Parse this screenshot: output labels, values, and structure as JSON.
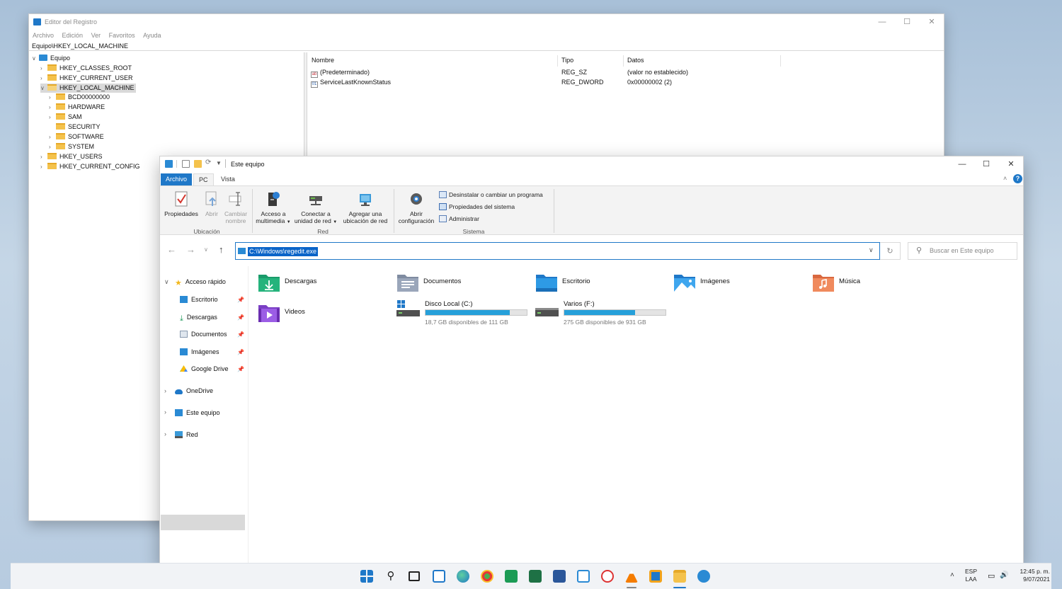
{
  "regedit": {
    "title": "Editor del Registro",
    "menu": [
      "Archivo",
      "Edición",
      "Ver",
      "Favoritos",
      "Ayuda"
    ],
    "address": "Equipo\\HKEY_LOCAL_MACHINE",
    "tree": {
      "root": "Equipo",
      "hkcr": "HKEY_CLASSES_ROOT",
      "hkcu": "HKEY_CURRENT_USER",
      "hklm": "HKEY_LOCAL_MACHINE",
      "bcd": "BCD00000000",
      "hardware": "HARDWARE",
      "sam": "SAM",
      "security": "SECURITY",
      "software": "SOFTWARE",
      "system": "SYSTEM",
      "hku": "HKEY_USERS",
      "hkcc": "HKEY_CURRENT_CONFIG"
    },
    "columns": {
      "name": "Nombre",
      "type": "Tipo",
      "data": "Datos"
    },
    "values": [
      {
        "name": "(Predeterminado)",
        "type": "REG_SZ",
        "data": "(valor no establecido)",
        "icon": "string-value-icon"
      },
      {
        "name": "ServiceLastKnownStatus",
        "type": "REG_DWORD",
        "data": "0x00000002 (2)",
        "icon": "dword-value-icon"
      }
    ]
  },
  "explorer": {
    "title": "Este equipo",
    "tabs": {
      "archivo": "Archivo",
      "pc": "PC",
      "vista": "Vista"
    },
    "ribbon": {
      "propiedades": "Propiedades",
      "abrir": "Abrir",
      "cambiar1": "Cambiar",
      "cambiar2": "nombre",
      "ubicacion_group": "Ubicación",
      "multimedia1": "Acceso a",
      "multimedia2": "multimedia",
      "conectar1": "Conectar a",
      "conectar2": "unidad de red",
      "agregar1": "Agregar una",
      "agregar2": "ubicación de red",
      "red_group": "Red",
      "config1": "Abrir",
      "config2": "configuración",
      "desinstalar": "Desinstalar o cambiar un programa",
      "propsistema": "Propiedades del sistema",
      "administrar": "Administrar",
      "sistema_group": "Sistema"
    },
    "address_value": "C:\\Windows\\regedit.exe",
    "search_placeholder": "Buscar en Este equipo",
    "nav": {
      "acceso_rapido": "Acceso rápido",
      "escritorio": "Escritorio",
      "descargas": "Descargas",
      "documentos": "Documentos",
      "imagenes": "Imágenes",
      "google_drive": "Google Drive",
      "onedrive": "OneDrive",
      "este_equipo": "Este equipo",
      "red": "Red"
    },
    "folders": {
      "descargas": "Descargas",
      "documentos": "Documentos",
      "escritorio": "Escritorio",
      "imagenes": "Imágenes",
      "musica": "Música",
      "videos": "Videos"
    },
    "drives": [
      {
        "name": "Disco Local (C:)",
        "space": "18,7 GB disponibles de 111 GB",
        "used_fraction": 0.83
      },
      {
        "name": "Varios (F:)",
        "space": "275 GB disponibles de 931 GB",
        "used_fraction": 0.7
      }
    ]
  },
  "taskbar": {
    "lang1": "ESP",
    "lang2": "LAA",
    "time": "12:45 p. m.",
    "date": "9/07/2021"
  },
  "colors": {
    "accent": "#1f78c8",
    "selection": "#0a64c8",
    "drive_bar": "#26a0da"
  }
}
